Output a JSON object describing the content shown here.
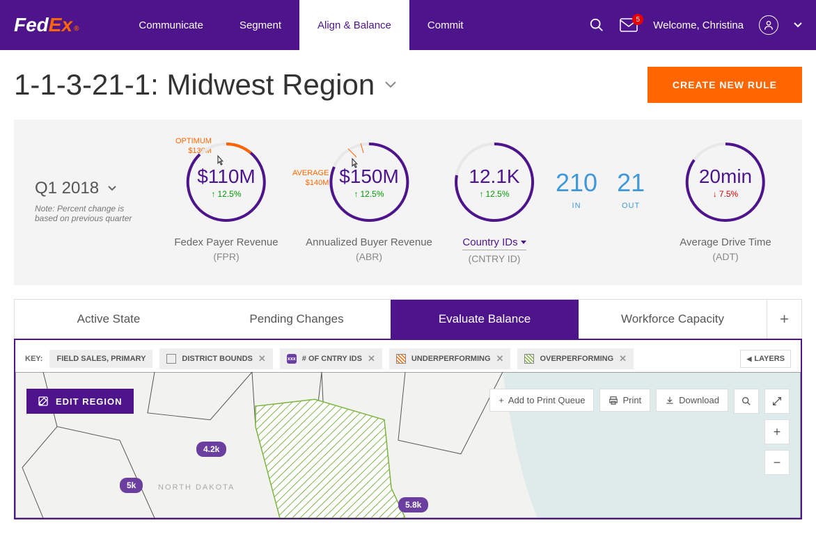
{
  "header": {
    "nav": [
      "Communicate",
      "Segment",
      "Align & Balance",
      "Commit"
    ],
    "active_nav": 2,
    "welcome": "Welcome, Christina",
    "badge": "5"
  },
  "title": {
    "text": "1-1-3-21-1: Midwest Region",
    "button": "CREATE NEW RULE"
  },
  "quarter": {
    "label": "Q1 2018",
    "note": "Note: Percent change is based on previous quarter"
  },
  "metrics": {
    "fpr": {
      "value": "$110M",
      "pct": "12.5%",
      "dir": "up",
      "label": "Fedex Payer Revenue",
      "sub": "(FPR)",
      "opt_label": "OPTIMUM",
      "opt_val": "$130M"
    },
    "abr": {
      "value": "$150M",
      "pct": "12.5%",
      "dir": "up",
      "label": "Annualized Buyer Revenue",
      "sub": "(ABR)",
      "avg_label": "AVERAGE",
      "avg_val": "$140M"
    },
    "cntry": {
      "value": "12.1K",
      "pct": "12.5%",
      "dir": "up",
      "label": "Country IDs",
      "sub": "(CNTRY ID)",
      "in_val": "210",
      "in_lab": "IN",
      "out_val": "21",
      "out_lab": "OUT"
    },
    "adt": {
      "value": "20min",
      "pct": "7.5%",
      "dir": "down",
      "label": "Average Drive Time",
      "sub": "(ADT)"
    }
  },
  "tabs": {
    "items": [
      "Active State",
      "Pending Changes",
      "Evaluate Balance",
      "Workforce Capacity"
    ],
    "active": 2
  },
  "key": {
    "label": "KEY:",
    "field_sales": "FIELD SALES, PRIMARY",
    "district": "DISTRICT BOUNDS",
    "cntry": "# OF CNTRY IDS",
    "under": "UNDERPERFORMING",
    "over": "OVERPERFORMING",
    "layers": "LAYERS"
  },
  "map": {
    "edit": "EDIT REGION",
    "print_queue": "Add to Print Queue",
    "print": "Print",
    "download": "Download",
    "tags": {
      "a": "4.2k",
      "b": "5k",
      "c": "5.8k"
    },
    "state": "NORTH DAKOTA"
  }
}
